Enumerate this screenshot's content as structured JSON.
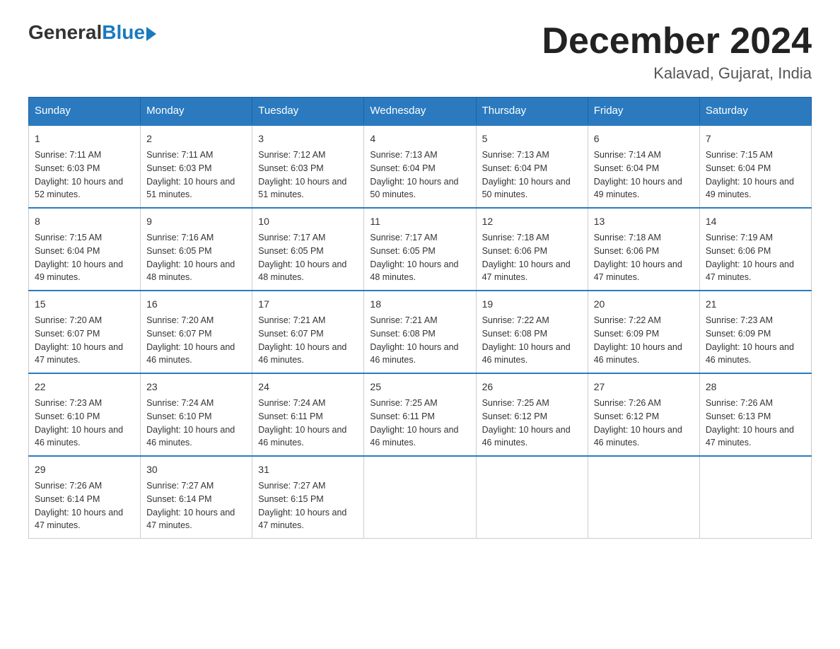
{
  "logo": {
    "general": "General",
    "blue": "Blue"
  },
  "title": {
    "month": "December 2024",
    "location": "Kalavad, Gujarat, India"
  },
  "days_of_week": [
    "Sunday",
    "Monday",
    "Tuesday",
    "Wednesday",
    "Thursday",
    "Friday",
    "Saturday"
  ],
  "weeks": [
    [
      {
        "day": "1",
        "sunrise": "7:11 AM",
        "sunset": "6:03 PM",
        "daylight": "10 hours and 52 minutes."
      },
      {
        "day": "2",
        "sunrise": "7:11 AM",
        "sunset": "6:03 PM",
        "daylight": "10 hours and 51 minutes."
      },
      {
        "day": "3",
        "sunrise": "7:12 AM",
        "sunset": "6:03 PM",
        "daylight": "10 hours and 51 minutes."
      },
      {
        "day": "4",
        "sunrise": "7:13 AM",
        "sunset": "6:04 PM",
        "daylight": "10 hours and 50 minutes."
      },
      {
        "day": "5",
        "sunrise": "7:13 AM",
        "sunset": "6:04 PM",
        "daylight": "10 hours and 50 minutes."
      },
      {
        "day": "6",
        "sunrise": "7:14 AM",
        "sunset": "6:04 PM",
        "daylight": "10 hours and 49 minutes."
      },
      {
        "day": "7",
        "sunrise": "7:15 AM",
        "sunset": "6:04 PM",
        "daylight": "10 hours and 49 minutes."
      }
    ],
    [
      {
        "day": "8",
        "sunrise": "7:15 AM",
        "sunset": "6:04 PM",
        "daylight": "10 hours and 49 minutes."
      },
      {
        "day": "9",
        "sunrise": "7:16 AM",
        "sunset": "6:05 PM",
        "daylight": "10 hours and 48 minutes."
      },
      {
        "day": "10",
        "sunrise": "7:17 AM",
        "sunset": "6:05 PM",
        "daylight": "10 hours and 48 minutes."
      },
      {
        "day": "11",
        "sunrise": "7:17 AM",
        "sunset": "6:05 PM",
        "daylight": "10 hours and 48 minutes."
      },
      {
        "day": "12",
        "sunrise": "7:18 AM",
        "sunset": "6:06 PM",
        "daylight": "10 hours and 47 minutes."
      },
      {
        "day": "13",
        "sunrise": "7:18 AM",
        "sunset": "6:06 PM",
        "daylight": "10 hours and 47 minutes."
      },
      {
        "day": "14",
        "sunrise": "7:19 AM",
        "sunset": "6:06 PM",
        "daylight": "10 hours and 47 minutes."
      }
    ],
    [
      {
        "day": "15",
        "sunrise": "7:20 AM",
        "sunset": "6:07 PM",
        "daylight": "10 hours and 47 minutes."
      },
      {
        "day": "16",
        "sunrise": "7:20 AM",
        "sunset": "6:07 PM",
        "daylight": "10 hours and 46 minutes."
      },
      {
        "day": "17",
        "sunrise": "7:21 AM",
        "sunset": "6:07 PM",
        "daylight": "10 hours and 46 minutes."
      },
      {
        "day": "18",
        "sunrise": "7:21 AM",
        "sunset": "6:08 PM",
        "daylight": "10 hours and 46 minutes."
      },
      {
        "day": "19",
        "sunrise": "7:22 AM",
        "sunset": "6:08 PM",
        "daylight": "10 hours and 46 minutes."
      },
      {
        "day": "20",
        "sunrise": "7:22 AM",
        "sunset": "6:09 PM",
        "daylight": "10 hours and 46 minutes."
      },
      {
        "day": "21",
        "sunrise": "7:23 AM",
        "sunset": "6:09 PM",
        "daylight": "10 hours and 46 minutes."
      }
    ],
    [
      {
        "day": "22",
        "sunrise": "7:23 AM",
        "sunset": "6:10 PM",
        "daylight": "10 hours and 46 minutes."
      },
      {
        "day": "23",
        "sunrise": "7:24 AM",
        "sunset": "6:10 PM",
        "daylight": "10 hours and 46 minutes."
      },
      {
        "day": "24",
        "sunrise": "7:24 AM",
        "sunset": "6:11 PM",
        "daylight": "10 hours and 46 minutes."
      },
      {
        "day": "25",
        "sunrise": "7:25 AM",
        "sunset": "6:11 PM",
        "daylight": "10 hours and 46 minutes."
      },
      {
        "day": "26",
        "sunrise": "7:25 AM",
        "sunset": "6:12 PM",
        "daylight": "10 hours and 46 minutes."
      },
      {
        "day": "27",
        "sunrise": "7:26 AM",
        "sunset": "6:12 PM",
        "daylight": "10 hours and 46 minutes."
      },
      {
        "day": "28",
        "sunrise": "7:26 AM",
        "sunset": "6:13 PM",
        "daylight": "10 hours and 47 minutes."
      }
    ],
    [
      {
        "day": "29",
        "sunrise": "7:26 AM",
        "sunset": "6:14 PM",
        "daylight": "10 hours and 47 minutes."
      },
      {
        "day": "30",
        "sunrise": "7:27 AM",
        "sunset": "6:14 PM",
        "daylight": "10 hours and 47 minutes."
      },
      {
        "day": "31",
        "sunrise": "7:27 AM",
        "sunset": "6:15 PM",
        "daylight": "10 hours and 47 minutes."
      },
      null,
      null,
      null,
      null
    ]
  ]
}
